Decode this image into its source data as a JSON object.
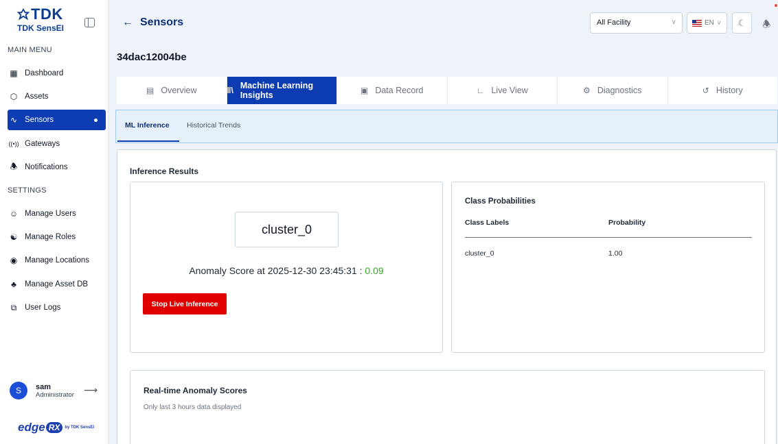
{
  "brand": {
    "logo": "TDK",
    "product": "TDK SensEI"
  },
  "sidebar": {
    "main_menu_label": "MAIN MENU",
    "settings_label": "SETTINGS",
    "items": [
      {
        "label": "Dashboard",
        "icon": "dashboard-icon"
      },
      {
        "label": "Assets",
        "icon": "cube-icon"
      },
      {
        "label": "Sensors",
        "icon": "pulse-icon",
        "active": true
      },
      {
        "label": "Gateways",
        "icon": "broadcast-icon"
      },
      {
        "label": "Notifications",
        "icon": "bell-icon"
      }
    ],
    "settings_items": [
      {
        "label": "Manage Users",
        "icon": "user-icon"
      },
      {
        "label": "Manage Roles",
        "icon": "roles-icon"
      },
      {
        "label": "Manage Locations",
        "icon": "location-icon"
      },
      {
        "label": "Manage Asset DB",
        "icon": "database-icon"
      },
      {
        "label": "User Logs",
        "icon": "logs-icon"
      }
    ]
  },
  "user": {
    "initial": "S",
    "name": "sam",
    "role": "Administrator"
  },
  "footer_brand": {
    "edge": "edge",
    "rx": "RX",
    "by": "by TDK SensEI"
  },
  "header": {
    "back_label": "Sensors",
    "facility": "All Facility",
    "language": "EN"
  },
  "device_id": "34dac12004be",
  "tabs": [
    {
      "label": "Overview",
      "icon": "document-icon"
    },
    {
      "label": "Machine Learning Insights",
      "icon": "bars-icon",
      "active": true
    },
    {
      "label": "Data Record",
      "icon": "record-icon"
    },
    {
      "label": "Live View",
      "icon": "chart-icon"
    },
    {
      "label": "Diagnostics",
      "icon": "diagnostics-icon"
    },
    {
      "label": "History",
      "icon": "history-icon"
    }
  ],
  "subtabs": [
    {
      "label": "ML Inference",
      "active": true
    },
    {
      "label": "Historical Trends"
    }
  ],
  "inference": {
    "title": "Inference Results",
    "cluster": "cluster_0",
    "anomaly_prefix": "Anomaly Score at 2025-12-30 23:45:31 : ",
    "anomaly_score": "0.09",
    "stop_button": "Stop Live Inference"
  },
  "class_probabilities": {
    "title": "Class Probabilities",
    "col_label": "Class Labels",
    "col_prob": "Probability",
    "rows": [
      {
        "label": "cluster_0",
        "probability": "1.00"
      }
    ]
  },
  "realtime": {
    "title": "Real-time Anomaly Scores",
    "subtitle": "Only last 3 hours data displayed"
  },
  "colors": {
    "primary": "#0d3bb1",
    "danger": "#e00000",
    "score_green": "#3aa52a"
  }
}
